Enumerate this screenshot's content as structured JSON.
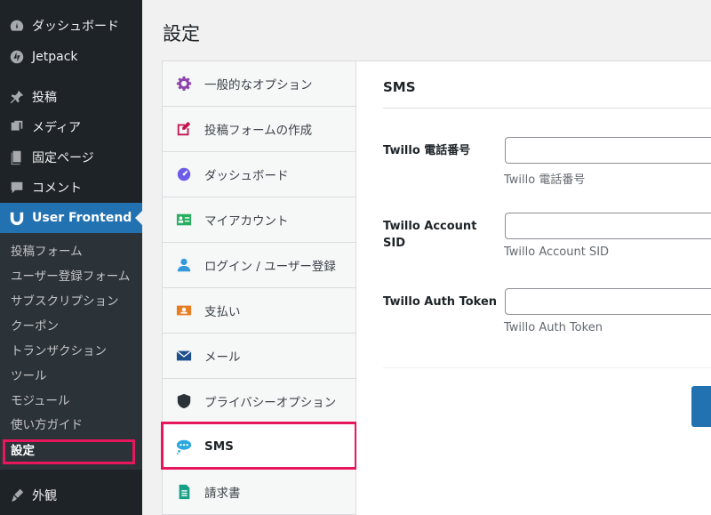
{
  "admin_menu": {
    "items": [
      {
        "label": "ダッシュボード",
        "icon": "dashboard-icon"
      },
      {
        "label": "Jetpack",
        "icon": "jetpack-icon"
      },
      {
        "label": "投稿",
        "icon": "pin-icon"
      },
      {
        "label": "メディア",
        "icon": "media-icon"
      },
      {
        "label": "固定ページ",
        "icon": "page-icon"
      },
      {
        "label": "コメント",
        "icon": "comment-icon"
      },
      {
        "label": "User Frontend",
        "icon": "user-frontend-icon"
      },
      {
        "label": "外観",
        "icon": "appearance-icon"
      }
    ],
    "submenu": [
      "投稿フォーム",
      "ユーザー登録フォーム",
      "サブスクリプション",
      "クーポン",
      "トランザクション",
      "ツール",
      "モジュール",
      "使い方ガイド",
      "設定"
    ]
  },
  "page": {
    "title": "設定"
  },
  "settings_nav": {
    "items": [
      {
        "label": "一般的なオプション",
        "icon": "gear-icon",
        "color": "#8e44ad"
      },
      {
        "label": "投稿フォームの作成",
        "icon": "edit-icon",
        "color": "#c0134f"
      },
      {
        "label": "ダッシュボード",
        "icon": "gauge-icon",
        "color": "#6c5ce7"
      },
      {
        "label": "マイアカウント",
        "icon": "id-card-icon",
        "color": "#27ae60"
      },
      {
        "label": "ログイン / ユーザー登録",
        "icon": "user-icon",
        "color": "#3498db"
      },
      {
        "label": "支払い",
        "icon": "payment-icon",
        "color": "#e67e22"
      },
      {
        "label": "メール",
        "icon": "mail-icon",
        "color": "#1e4f8c"
      },
      {
        "label": "プライバシーオプション",
        "icon": "shield-icon",
        "color": "#2c3338"
      },
      {
        "label": "SMS",
        "icon": "chat-icon",
        "color": "#29a8e0"
      },
      {
        "label": "請求書",
        "icon": "invoice-icon",
        "color": "#16a085"
      }
    ]
  },
  "panel": {
    "title": "SMS",
    "fields": [
      {
        "label": "Twillo 電話番号",
        "value": "",
        "desc": "Twillo 電話番号"
      },
      {
        "label": "Twillo Account SID",
        "value": "",
        "desc": "Twillo Account SID"
      },
      {
        "label": "Twillo Auth Token",
        "value": "",
        "desc": "Twillo Auth Token"
      }
    ]
  },
  "colors": {
    "accent": "#2271b1",
    "highlight": "#e6175c",
    "sidebar": "#1d2327"
  }
}
